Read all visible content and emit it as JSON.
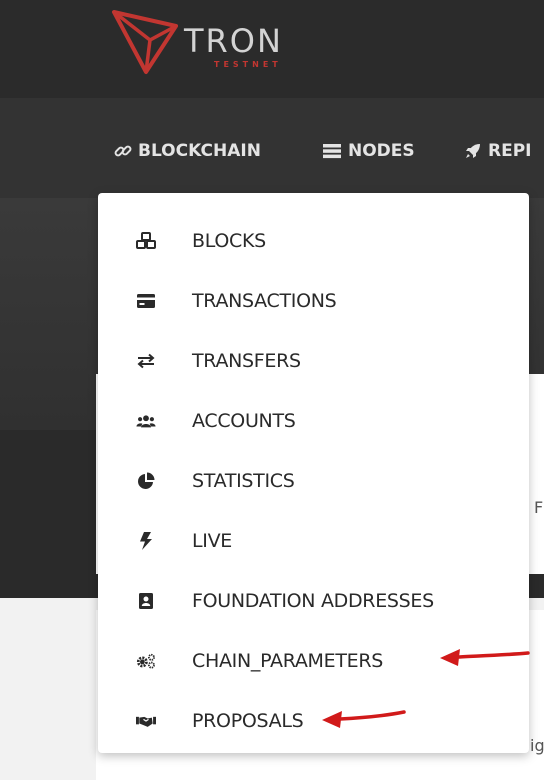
{
  "header": {
    "logo_wordmark": "TRON",
    "logo_sub": "TESTNET"
  },
  "nav": {
    "items": [
      {
        "label": "BLOCKCHAIN",
        "icon": "link-icon"
      },
      {
        "label": "NODES",
        "icon": "server-icon"
      },
      {
        "label": "REPI",
        "icon": "rocket-icon"
      }
    ]
  },
  "dropdown": {
    "items": [
      {
        "label": "BLOCKS",
        "icon": "cubes-icon"
      },
      {
        "label": "TRANSACTIONS",
        "icon": "credit-card-icon"
      },
      {
        "label": "TRANSFERS",
        "icon": "exchange-icon"
      },
      {
        "label": "ACCOUNTS",
        "icon": "users-icon"
      },
      {
        "label": "STATISTICS",
        "icon": "pie-chart-icon"
      },
      {
        "label": "LIVE",
        "icon": "bolt-icon"
      },
      {
        "label": "FOUNDATION ADDRESSES",
        "icon": "address-book-icon"
      },
      {
        "label": "CHAIN_PARAMETERS",
        "icon": "cogs-icon"
      },
      {
        "label": "PROPOSALS",
        "icon": "handshake-icon"
      }
    ]
  },
  "page": {
    "peek_right": "F",
    "peek_bottom": "ig"
  },
  "colors": {
    "header_bg": "#2b2b2b",
    "accent_red": "#c23631",
    "annotation_arrow": "#d11a1a"
  }
}
